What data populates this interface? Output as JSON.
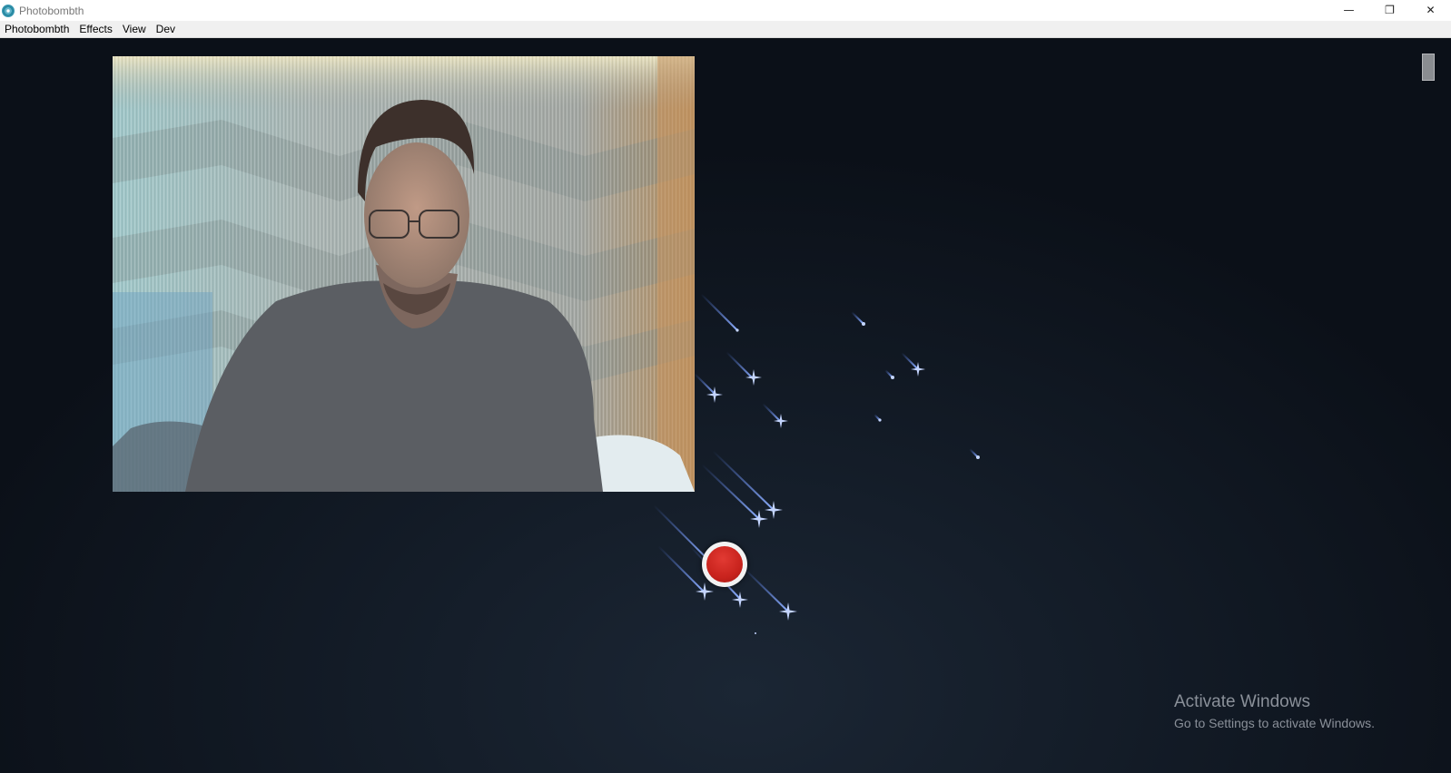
{
  "window": {
    "title": "Photobombth",
    "icon": "app-logo-icon",
    "controls": {
      "minimize": "—",
      "restore": "❐",
      "close": "✕"
    }
  },
  "menu": {
    "items": [
      "Photobombth",
      "Effects",
      "View",
      "Dev"
    ]
  },
  "camera": {
    "label": "webcam-preview"
  },
  "record": {
    "icon": "record-icon",
    "color": "#c8231d"
  },
  "watermark": {
    "title": "Activate Windows",
    "subtitle": "Go to Settings to activate Windows."
  },
  "colors": {
    "background": "#0d131c",
    "sparkle": "#5b86ff"
  }
}
